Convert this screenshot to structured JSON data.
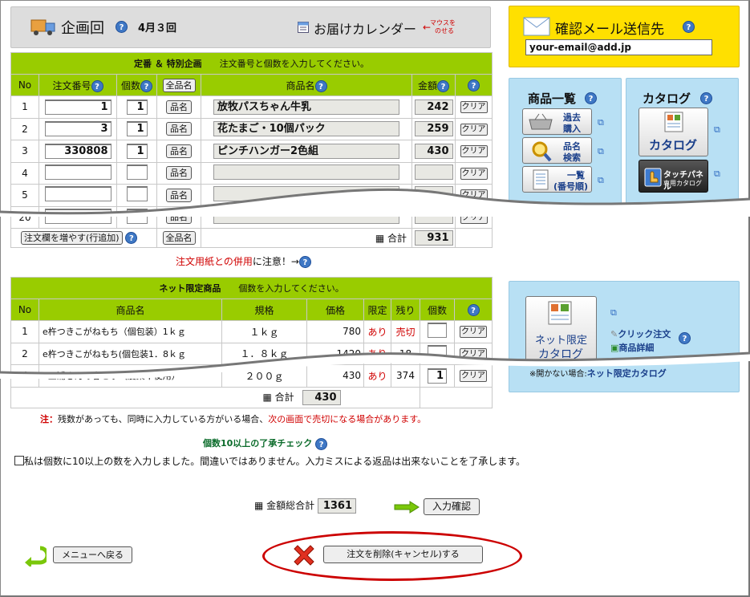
{
  "header": {
    "title": "企画回",
    "round": "4月３回",
    "calendar": "お届けカレンダー",
    "hover_note_1": "マウスを",
    "hover_note_2": "のせる"
  },
  "email": {
    "title": "確認メール送信先",
    "value": "your-email@add.jp"
  },
  "order_table": {
    "group_title": "定番 ＆ 特別企画",
    "instruction": "注文番号と個数を入力してください。",
    "col_no": "No",
    "col_order_no": "注文番号",
    "col_qty": "個数",
    "col_all_names": "全品名",
    "col_name": "商品名",
    "col_price": "金額",
    "name_btn": "品名",
    "clear_btn": "クリア",
    "rows": [
      {
        "no": "1",
        "order_no": "1",
        "qty": "1",
        "name": "放牧パスちゃん牛乳",
        "price": "242"
      },
      {
        "no": "2",
        "order_no": "3",
        "qty": "1",
        "name": "花たまご・10個パック",
        "price": "259"
      },
      {
        "no": "3",
        "order_no": "330808",
        "qty": "1",
        "name": "ピンチハンガー2色組",
        "price": "430"
      },
      {
        "no": "4",
        "order_no": "",
        "qty": "",
        "name": "",
        "price": ""
      },
      {
        "no": "5",
        "order_no": "",
        "qty": "",
        "name": "",
        "price": ""
      },
      {
        "no": "20",
        "order_no": "",
        "qty": "",
        "name": "",
        "price": ""
      }
    ],
    "add_rows_btn": "注文欄を増やす(行追加)",
    "all_names_btn": "全品名",
    "total_label": "合計",
    "total": "931",
    "note_pre": "注文用紙との併用",
    "note_post": "に注意！→"
  },
  "net_table": {
    "group_title": "ネット限定商品",
    "instruction": "個数を入力してください。",
    "col_no": "No",
    "col_name": "商品名",
    "col_spec": "規格",
    "col_price": "価格",
    "col_limited": "限定",
    "col_remaining": "残り",
    "col_qty": "個数",
    "clear_btn": "クリア",
    "rows": [
      {
        "no": "1",
        "name": "e杵つきこがねもち（個包装）1ｋｇ",
        "spec": "１ｋｇ",
        "price": "780",
        "limited": "あり",
        "remaining": "売切",
        "qty": ""
      },
      {
        "no": "2",
        "name": "e杵つきこがねもち(個包装1．8ｋｇ",
        "spec": "１．８ｋｇ",
        "price": "1420",
        "limited": "あり",
        "remaining": "18",
        "qty": ""
      },
      {
        "no": "4",
        "name": "e三浦さんの春せり（農薬不使用）",
        "spec": "２００ｇ",
        "price": "430",
        "limited": "あり",
        "remaining": "374",
        "qty": "1"
      }
    ],
    "total_label": "合計",
    "total": "430"
  },
  "caution": {
    "label": "注：",
    "text1": "残数があっても、同時に入力している方がいる場合、",
    "text2": "次の画面で売切になる場合があります。"
  },
  "check": {
    "title": "個数10以上の了承チェック",
    "label": "私は個数に10以上の数を入力しました。間違いではありません。入力ミスによる返品は出来ないことを了承します。"
  },
  "grand": {
    "label": "金額総合計",
    "value": "1361",
    "confirm_btn": "入力確認"
  },
  "footer": {
    "back_btn": "メニューへ戻る",
    "delete_btn": "注文を削除(キャンセル)する"
  },
  "sidebar": {
    "product_list": "商品一覧",
    "past_1": "過去",
    "past_2": "購入",
    "search_1": "品名",
    "search_2": "検索",
    "list_1": "一覧",
    "list_2": "(番号順)",
    "catalog_title": "カタログ",
    "catalog_btn": "カタログ",
    "touch_1": "タッチパネル",
    "touch_2": "専用カタログ",
    "net_btn_1": "ネット限定",
    "net_btn_2": "カタログ",
    "click_order": "クリック注文",
    "detail": "商品詳細",
    "net_note_pre": "※開かない場合:",
    "net_note_link": "ネット限定カタログ"
  },
  "colors": {
    "green_header": "#99cc00",
    "panel_blue": "#b8e0f4",
    "email_yellow": "#ffe000",
    "alert_red": "#d00000"
  }
}
